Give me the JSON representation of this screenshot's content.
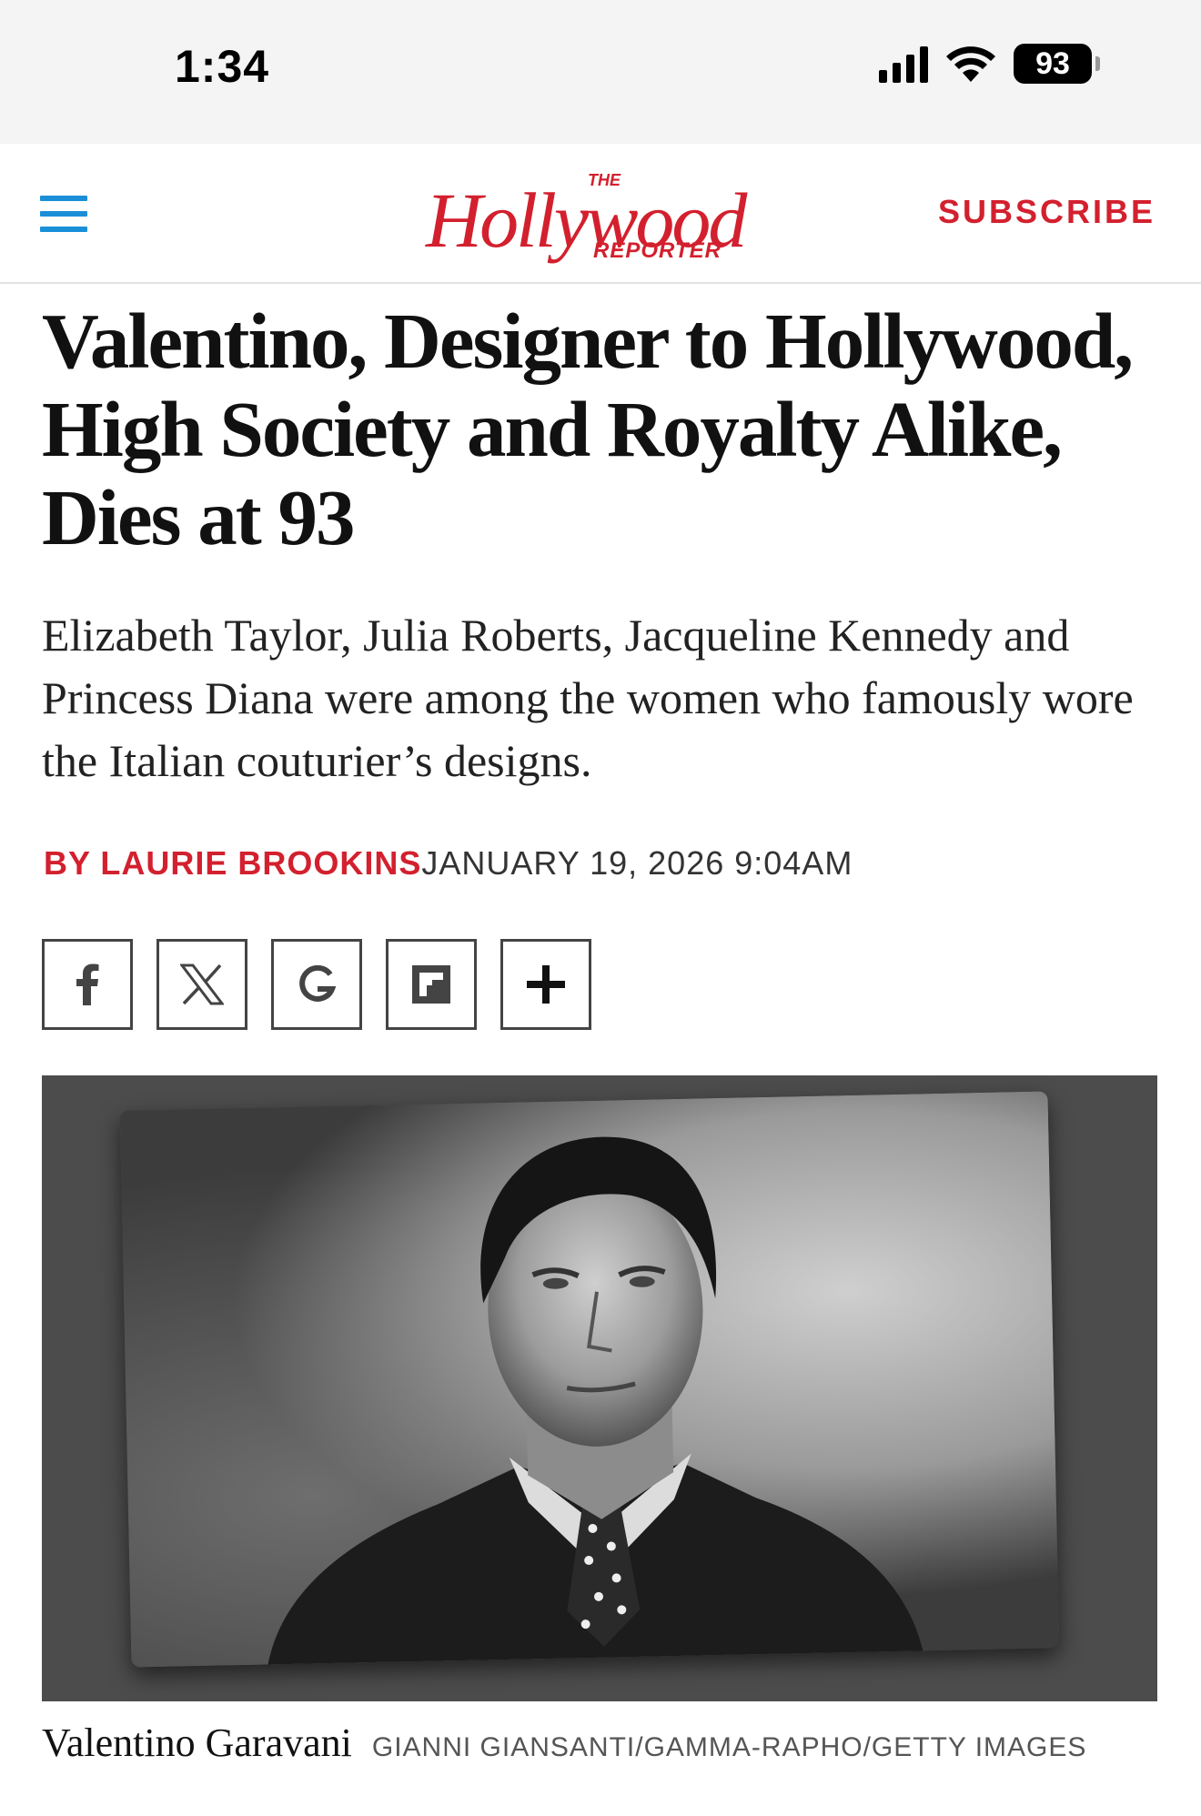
{
  "status_bar": {
    "time": "1:34",
    "battery": "93"
  },
  "header": {
    "logo_the": "THE",
    "logo_main": "Hollywood",
    "logo_reporter": "REPORTER",
    "subscribe_label": "SUBSCRIBE",
    "accent_color": "#d3202e",
    "menu_color": "#1a8fd8"
  },
  "article": {
    "headline": "Valentino, Designer to Hollywood, High Society and Royalty Alike, Dies at 93",
    "dek": "Elizabeth Taylor, Julia Roberts, Jacqueline Kennedy and Princess Diana were among the women who famously wore the Italian couturier’s designs.",
    "byline": "BY LAURIE BROOKINS",
    "date": "JANUARY 19, 2026 9:04AM"
  },
  "share": {
    "buttons": [
      {
        "icon": "facebook-icon"
      },
      {
        "icon": "x-icon"
      },
      {
        "icon": "google-icon"
      },
      {
        "icon": "flipboard-icon"
      },
      {
        "icon": "plus-icon"
      }
    ]
  },
  "photo": {
    "caption": "Valentino Garavani",
    "credit": "GIANNI GIANSANTI/GAMMA-RAPHO/GETTY IMAGES"
  }
}
